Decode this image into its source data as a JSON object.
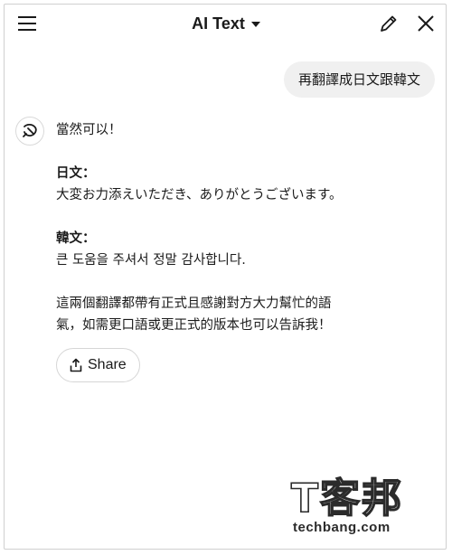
{
  "header": {
    "title": "AI Text",
    "menu_icon": "hamburger-menu-icon",
    "edit_icon": "pencil-icon",
    "close_icon": "close-icon"
  },
  "chat": {
    "user_message": "再翻譯成日文跟韓文",
    "assistant": {
      "intro": "當然可以！",
      "japanese_heading": "日文：",
      "japanese_text": "大変お力添えいただき、ありがとうございます。",
      "korean_heading": "韓文：",
      "korean_text": "큰 도움을 주셔서 정말 감사합니다.",
      "note_line1": "這兩個翻譯都帶有正式且感謝對方大力幫忙的語",
      "note_line2": "氣，如需更口語或更正式的版本也可以告訴我！"
    },
    "share_label": "Share"
  },
  "watermark": {
    "logo": "T客邦",
    "url": "techbang.com"
  }
}
